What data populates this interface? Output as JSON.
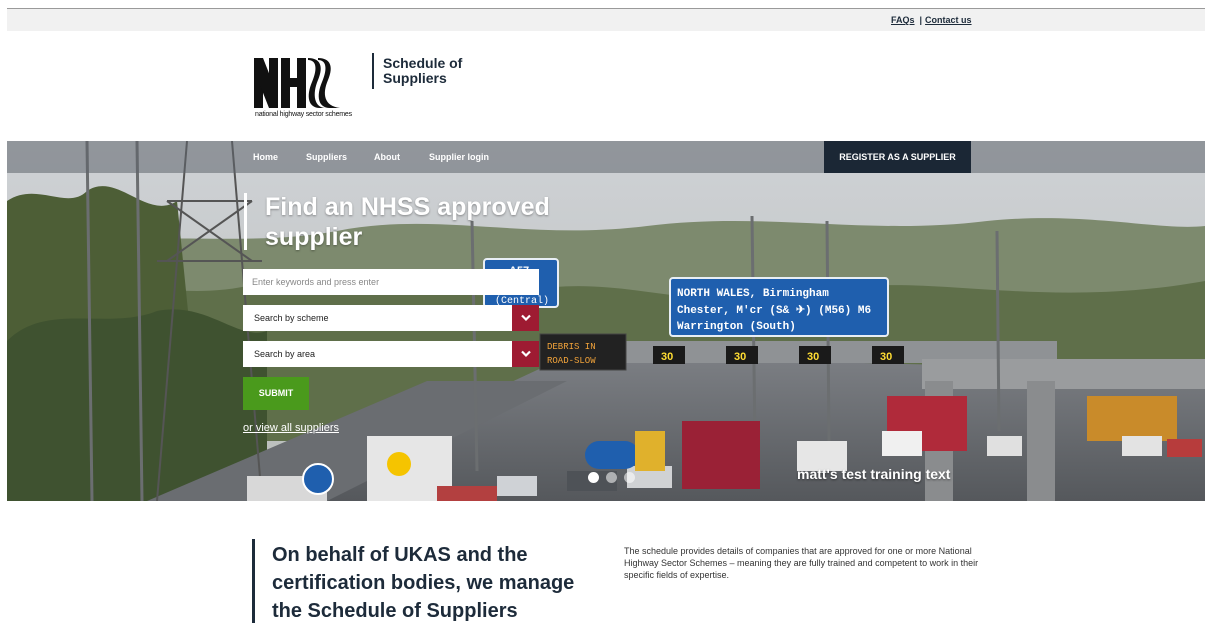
{
  "topbar": {
    "faqs": "FAQs",
    "separator": "|",
    "contact": "Contact us"
  },
  "brand": {
    "logo_text": "NHSS",
    "logo_tagline": "national highway sector schemes",
    "title": "Schedule of Suppliers"
  },
  "nav": {
    "items": [
      {
        "label": "Home"
      },
      {
        "label": "Suppliers"
      },
      {
        "label": "About"
      },
      {
        "label": "Supplier login"
      }
    ],
    "register": "REGISTER AS A SUPPLIER"
  },
  "hero": {
    "title": "Find an NHSS approved supplier",
    "search_placeholder": "Enter keywords and press enter",
    "scheme_select": "Search by scheme",
    "area_select": "Search by area",
    "submit": "SUBMIT",
    "view_all": "or view all suppliers",
    "caption": "matt's test training text",
    "slides": 3,
    "active_slide": 1,
    "image_signs": {
      "sign_main_line1": "NORTH WALES, Birmingham",
      "sign_main_line2": "Chester, M'cr (S& ✈) (M56) M6",
      "sign_main_line3": "Warrington (South)",
      "sign_left": "(Central)",
      "sign_left_road": "A57",
      "matrix_line1": "DEBRIS IN",
      "matrix_line2": "ROAD-SLOW",
      "speed": "30"
    }
  },
  "intro": {
    "heading": "On behalf of UKAS and the certification bodies, we manage the Schedule of Suppliers",
    "text": "The schedule provides details of companies that are approved for one or more National Highway Sector Schemes – meaning they are fully trained and competent to work in their specific fields of expertise."
  },
  "colors": {
    "navy": "#1b2735",
    "register_bg": "#1b2735",
    "select_button": "#9e1b32",
    "submit": "#4a9a1c",
    "sign_blue": "#1f5fae"
  }
}
